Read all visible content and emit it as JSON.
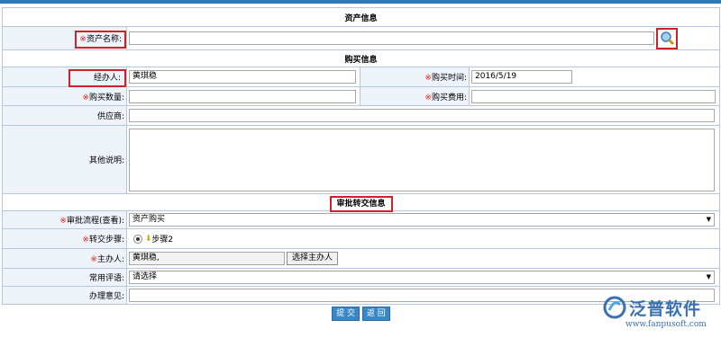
{
  "sections": {
    "asset_info": "资产信息",
    "purchase_info": "购买信息",
    "approval_info": "审批转交信息"
  },
  "fields": {
    "asset_name": {
      "required_mark": "※",
      "label": "资产名称:",
      "value": ""
    },
    "handler": {
      "label": "经办人:",
      "value": "黄琪稳"
    },
    "purchase_time": {
      "required_mark": "※",
      "label": "购买时间:",
      "value": "2016/5/19"
    },
    "purchase_qty": {
      "required_mark": "※",
      "label": "购买数量:",
      "value": ""
    },
    "purchase_cost": {
      "required_mark": "※",
      "label": "购买费用:",
      "value": ""
    },
    "supplier": {
      "label": "供应商:",
      "value": ""
    },
    "other_notes": {
      "label": "其他说明:",
      "value": ""
    },
    "approval_flow": {
      "required_mark": "※",
      "label": "审批流程(查看):",
      "value": "资产购买"
    },
    "transfer_step": {
      "required_mark": "※",
      "label": "转交步骤:",
      "option": "步骤2"
    },
    "main_handler": {
      "required_mark": "※",
      "label": "主办人:",
      "value": "黄琪稳,",
      "button": "选择主办人"
    },
    "common_phrases": {
      "label": "常用评语:",
      "value": "请选择"
    },
    "opinion": {
      "label": "办理意见:",
      "value": ""
    }
  },
  "buttons": {
    "submit": "提 交",
    "back": "返 回"
  },
  "logo": {
    "name": "泛普软件",
    "url": "www.fanpusoft.com"
  },
  "colors": {
    "accent": "#2e79bd",
    "required": "#e02020",
    "highlight": "#d0202a",
    "label_bg": "#eef3f9"
  }
}
